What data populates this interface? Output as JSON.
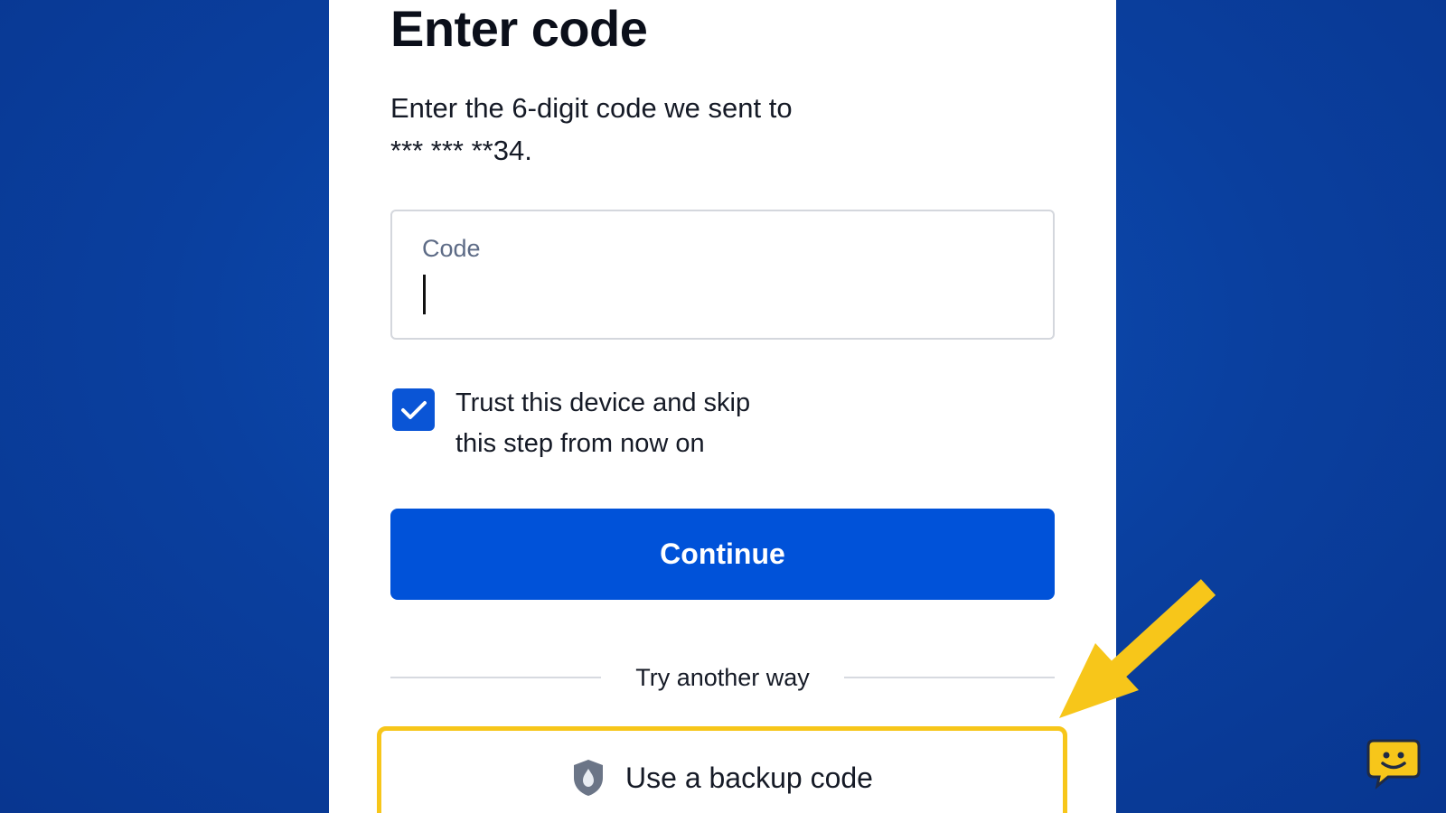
{
  "colors": {
    "background": "#0a43a6",
    "primary": "#0052d9",
    "highlight": "#f7c61a"
  },
  "page": {
    "title": "Enter code",
    "description_lines": [
      "Enter the 6-digit code we sent to",
      "*** *** **34."
    ]
  },
  "code_input": {
    "label": "Code",
    "value": ""
  },
  "trust_device": {
    "checked": true,
    "label_lines": [
      "Trust this device and skip",
      "this step from now on"
    ]
  },
  "continue_button": {
    "label": "Continue"
  },
  "alternatives": {
    "divider_text": "Try another way",
    "backup_option": {
      "label": "Use a backup code",
      "icon": "shield-icon"
    }
  },
  "annotation": {
    "icon": "arrow-icon",
    "color": "#f7c61a"
  },
  "chat": {
    "icon": "chat-smiley-icon",
    "color": "#f7c61a"
  }
}
